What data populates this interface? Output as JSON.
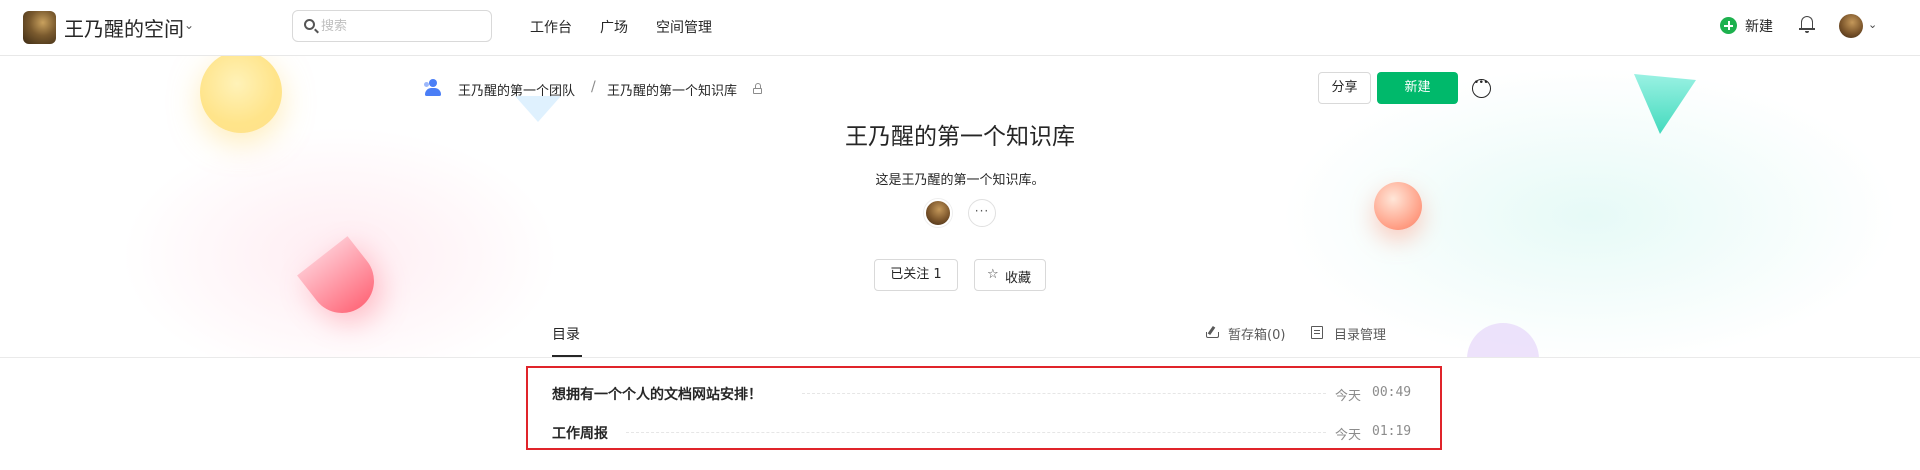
{
  "header": {
    "space_title": "王乃醒的空间",
    "search_placeholder": "搜索",
    "nav": [
      "工作台",
      "广场",
      "空间管理"
    ],
    "new_label": "新建"
  },
  "breadcrumb": {
    "team": "王乃醒的第一个团队",
    "separator": "/",
    "book": "王乃醒的第一个知识库"
  },
  "actions": {
    "share": "分享",
    "new": "新建"
  },
  "repo": {
    "title": "王乃醒的第一个知识库",
    "description": "这是王乃醒的第一个知识库。",
    "members_more": "···",
    "follow_label": "已关注 1",
    "favorite_label": "收藏"
  },
  "tabs": {
    "toc": "目录",
    "drafts": "暂存箱(0)",
    "toc_manage": "目录管理"
  },
  "docs": [
    {
      "title": "想拥有一个个人的文档网站安排！",
      "date": "今天",
      "time": "00:49"
    },
    {
      "title": "工作周报",
      "date": "今天",
      "time": "01:19"
    }
  ],
  "colors": {
    "accent": "#00b96b",
    "highlight_border": "#e0242a"
  }
}
